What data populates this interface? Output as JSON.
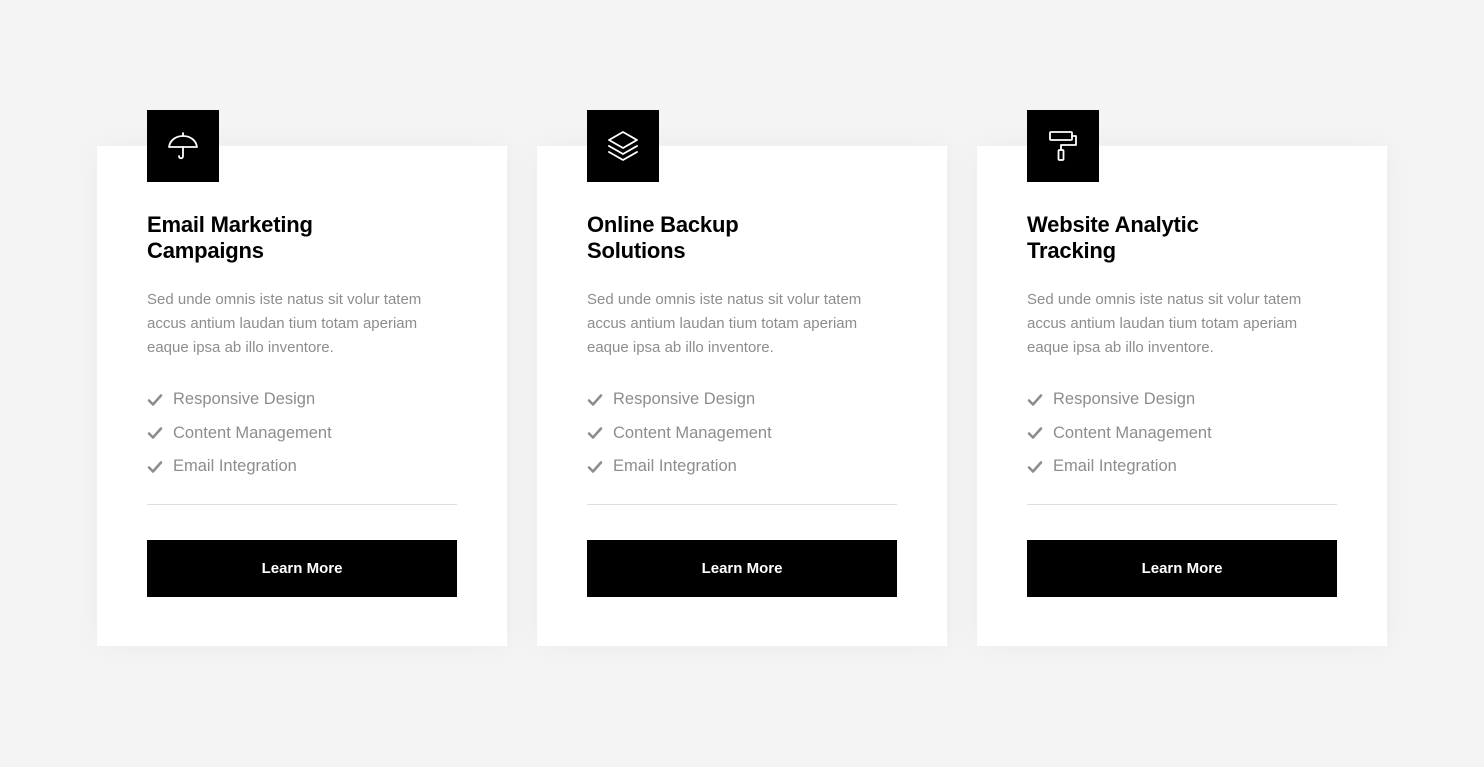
{
  "cards": [
    {
      "icon": "umbrella-icon",
      "title_line1": "Email Marketing",
      "title_line2": "Campaigns",
      "description": "Sed unde omnis iste natus sit volur tatem accus antium laudan tium totam aperiam eaque ipsa ab illo inventore.",
      "features": [
        "Responsive Design",
        "Content Management",
        "Email Integration"
      ],
      "button_label": "Learn More"
    },
    {
      "icon": "layers-icon",
      "title_line1": "Online Backup",
      "title_line2": "Solutions",
      "description": "Sed unde omnis iste natus sit volur tatem accus antium laudan tium totam aperiam eaque ipsa ab illo inventore.",
      "features": [
        "Responsive Design",
        "Content Management",
        "Email Integration"
      ],
      "button_label": "Learn More"
    },
    {
      "icon": "paint-roller-icon",
      "title_line1": "Website Analytic",
      "title_line2": "Tracking",
      "description": "Sed unde omnis iste natus sit volur tatem accus antium laudan tium totam aperiam eaque ipsa ab illo inventore.",
      "features": [
        "Responsive Design",
        "Content Management",
        "Email Integration"
      ],
      "button_label": "Learn More"
    }
  ],
  "colors": {
    "background": "#f4f4f4",
    "card": "#ffffff",
    "accent": "#000000",
    "muted_text": "#8d8d8d",
    "divider": "#dedede"
  }
}
